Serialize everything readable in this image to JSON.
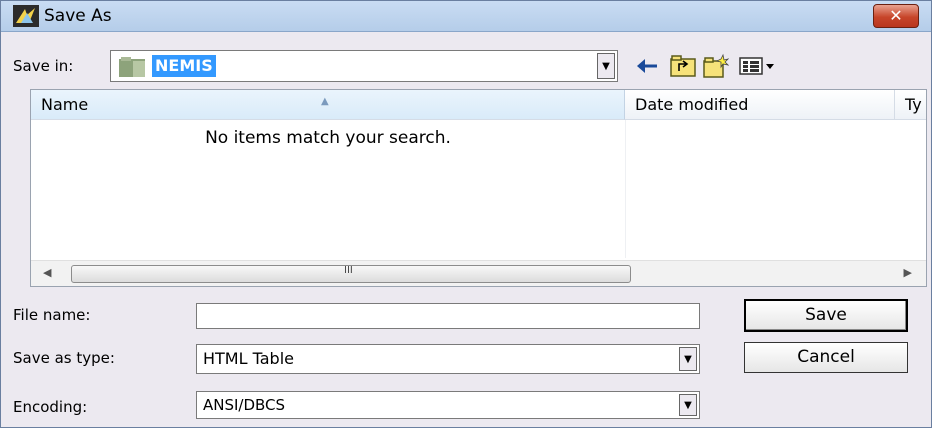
{
  "window": {
    "title": "Save As",
    "close_label": "✕"
  },
  "toolbar": {
    "save_in_label": "Save in:",
    "save_in_value": "NEMIS",
    "icons": [
      "back-arrow-icon",
      "up-folder-icon",
      "new-folder-icon",
      "view-menu-icon"
    ]
  },
  "file_list": {
    "columns": [
      "Name",
      "Date modified",
      "Ty"
    ],
    "empty_message": "No items match your search.",
    "scroll_grip": "III"
  },
  "form": {
    "file_name_label": "File name:",
    "file_name_value": "",
    "save_as_type_label": "Save as type:",
    "save_as_type_value": "HTML Table",
    "encoding_label": "Encoding:",
    "encoding_value": "ANSI/DBCS"
  },
  "buttons": {
    "save": "Save",
    "cancel": "Cancel"
  },
  "colors": {
    "selection": "#3399ff",
    "close": "#c7452a",
    "titlebar": "#c9dcf3"
  }
}
